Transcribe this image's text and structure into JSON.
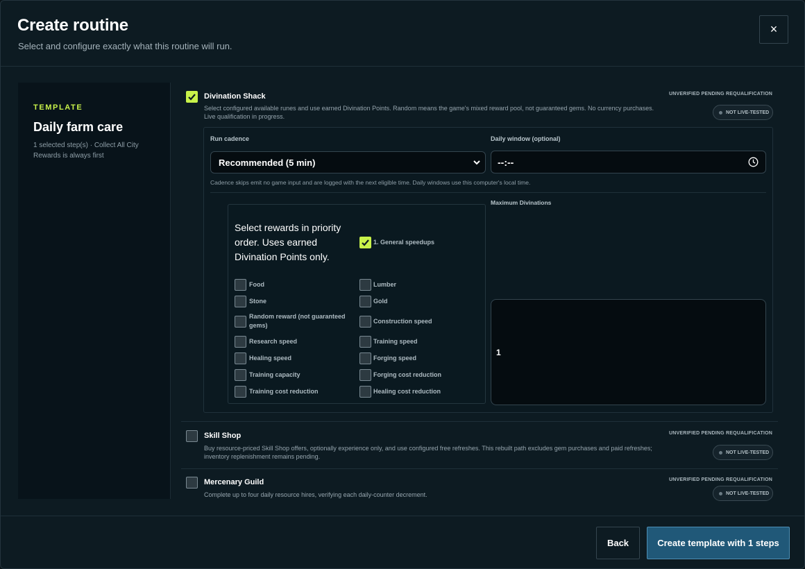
{
  "header": {
    "title": "Create routine",
    "subtitle": "Select and configure exactly what this routine will run.",
    "close_label": "×"
  },
  "sidebar": {
    "kicker": "TEMPLATE",
    "title": "Daily farm care",
    "description": "1 selected step(s) · Collect All City Rewards is always first"
  },
  "steps": [
    {
      "name": "Divination Shack",
      "checked": true,
      "description": "Select configured available runes and use earned Divination Points. Random means the game's mixed reward pool, not guaranteed gems. No currency purchases. Live qualification in progress.",
      "status": "UNVERIFIED PENDING REQUALIFICATION",
      "badge": "NOT LIVE-TESTED"
    },
    {
      "name": "Skill Shop",
      "checked": false,
      "description": "Buy resource-priced Skill Shop offers, optionally experience only, and use configured free refreshes. This rebuilt path excludes gem purchases and paid refreshes; inventory replenishment remains pending.",
      "status": "UNVERIFIED PENDING REQUALIFICATION",
      "badge": "NOT LIVE-TESTED"
    },
    {
      "name": "Mercenary Guild",
      "checked": false,
      "description": "Complete up to four daily resource hires, verifying each daily-counter decrement.",
      "status": "UNVERIFIED PENDING REQUALIFICATION",
      "badge": "NOT LIVE-TESTED"
    }
  ],
  "config": {
    "cadence_label": "Run cadence",
    "cadence_value": "Recommended (5 min)",
    "window_label": "Daily window (optional)",
    "window_value": "--:--",
    "hint": "Cadence skips emit no game input and are logged with the next eligible time. Daily windows use this computer's local time.",
    "rewards_heading": "Select rewards in priority order. Uses earned Divination Points only.",
    "max_label": "Maximum Divinations",
    "max_value": "1"
  },
  "rewards": {
    "selected": [
      {
        "label": "1. General speedups",
        "checked": true
      }
    ],
    "options_left": [
      {
        "label": "Food",
        "checked": false
      },
      {
        "label": "Stone",
        "checked": false
      },
      {
        "label": "Random reward (not guaranteed gems)",
        "checked": false
      },
      {
        "label": "Research speed",
        "checked": false
      },
      {
        "label": "Healing speed",
        "checked": false
      },
      {
        "label": "Training capacity",
        "checked": false
      },
      {
        "label": "Training cost reduction",
        "checked": false
      }
    ],
    "options_right": [
      {
        "label": "Lumber",
        "checked": false
      },
      {
        "label": "Gold",
        "checked": false
      },
      {
        "label": "Construction speed",
        "checked": false
      },
      {
        "label": "Training speed",
        "checked": false
      },
      {
        "label": "Forging speed",
        "checked": false
      },
      {
        "label": "Forging cost reduction",
        "checked": false
      },
      {
        "label": "Healing cost reduction",
        "checked": false
      }
    ]
  },
  "footer": {
    "back_label": "Back",
    "create_label": "Create template with 1 steps"
  },
  "colors": {
    "accent": "#c8f24a",
    "primary_button": "#205878",
    "background": "#0d1b22"
  }
}
